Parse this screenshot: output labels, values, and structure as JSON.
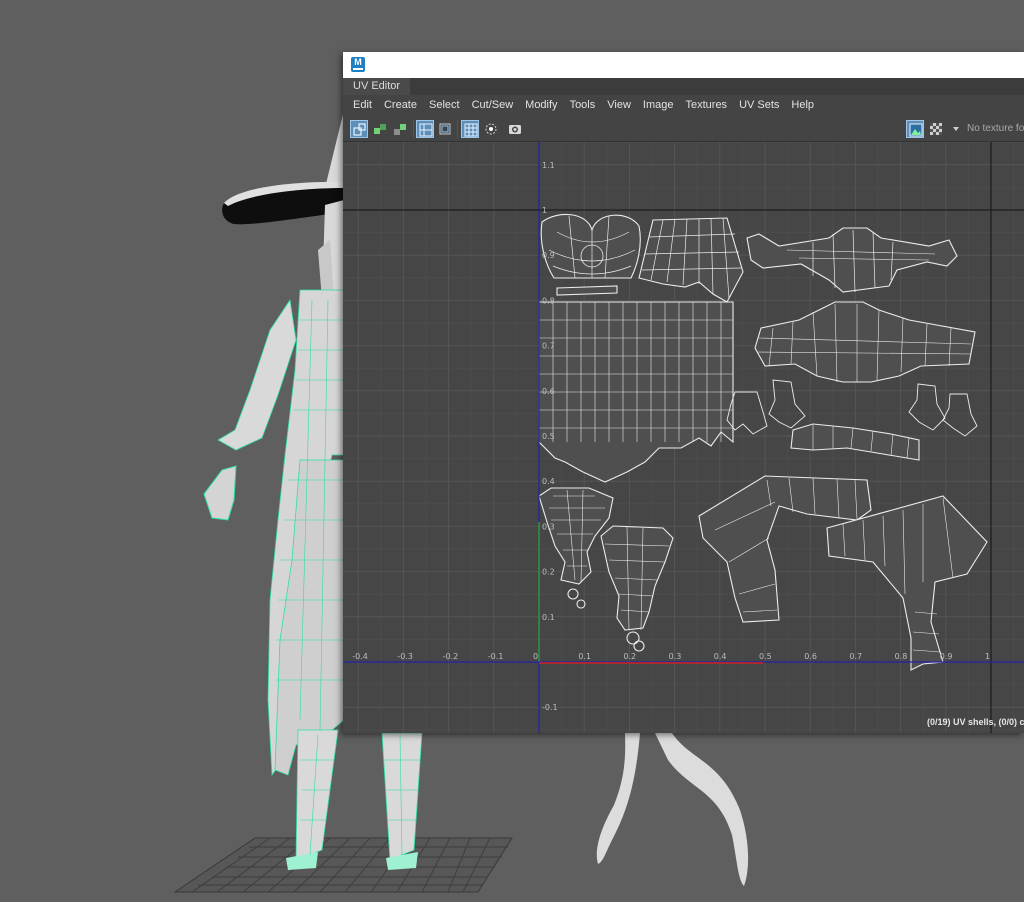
{
  "window": {
    "panel_title": "UV Editor",
    "app_logo": "M"
  },
  "menu": [
    "Edit",
    "Create",
    "Select",
    "Cut/Sew",
    "Modify",
    "Tools",
    "View",
    "Image",
    "Textures",
    "UV Sets",
    "Help"
  ],
  "toolbar": {
    "texture_status": "No texture fo",
    "icons": [
      "uv-shell-select-icon",
      "uv-layout-icon",
      "uv-stack-icon",
      "grid-toggle-icon",
      "texture-border-icon",
      "pixel-snap-icon",
      "isolate-icon",
      "snapshot-icon",
      "image-display-icon",
      "checker-icon",
      "dropdown-arrow-icon"
    ]
  },
  "axis": {
    "x_ticks": [
      "-0.4",
      "-0.3",
      "-0.2",
      "-0.1",
      "0",
      "0.1",
      "0.2",
      "0.3",
      "0.4",
      "0.5",
      "0.6",
      "0.7",
      "0.8",
      "0.9",
      "1"
    ],
    "y_ticks": [
      "1.1",
      "1",
      "0.9",
      "0.8",
      "0.7",
      "0.6",
      "0.5",
      "0.4",
      "0.3",
      "0.2",
      "0.1",
      "-0.1"
    ]
  },
  "status": {
    "uv_shells": "(0/19) UV shells, (0/0) c"
  },
  "colors": {
    "background": "#5f5f5f",
    "panel": "#444444",
    "accent": "#5e8fb8",
    "wireframe": "#e8e8e8",
    "u_axis": "#d42020",
    "v_axis": "#2e9c3a",
    "axis_blue": "#2222aa",
    "mesh_highlight": "#2de0a5"
  }
}
